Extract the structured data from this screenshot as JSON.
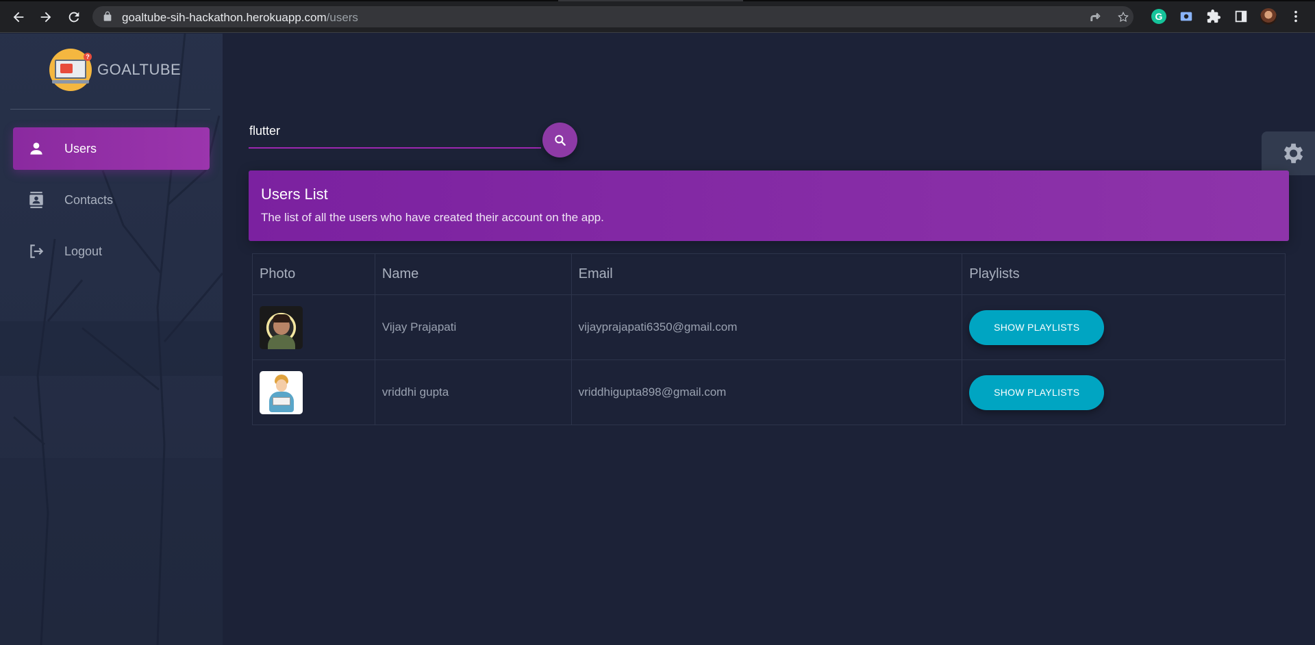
{
  "browser": {
    "url_host": "goaltube-sih-hackathon.herokuapp.com",
    "url_path": "/users",
    "icons": [
      "back-icon",
      "forward-icon",
      "reload-icon",
      "lock-icon",
      "share-icon",
      "star-icon",
      "grammarly-icon",
      "screencast-icon",
      "extensions-icon",
      "side-panel-icon",
      "profile-avatar",
      "menu-icon"
    ],
    "grammarly_letter": "G"
  },
  "sidebar": {
    "brand": "GOALTUBE",
    "items": [
      {
        "label": "Users",
        "icon": "person-icon",
        "active": true
      },
      {
        "label": "Contacts",
        "icon": "contacts-icon",
        "active": false
      },
      {
        "label": "Logout",
        "icon": "logout-icon",
        "active": false
      }
    ]
  },
  "search": {
    "value": "flutter",
    "button_icon": "search-icon"
  },
  "card": {
    "title": "Users List",
    "subtitle": "The list of all the users who have created their account on the app."
  },
  "table": {
    "headers": [
      "Photo",
      "Name",
      "Email",
      "Playlists"
    ],
    "rows": [
      {
        "name": "Vijay Prajapati",
        "email": "vijayprajapati6350@gmail.com",
        "button": "SHOW PLAYLISTS"
      },
      {
        "name": "vriddhi gupta",
        "email": "vriddhigupta898@gmail.com",
        "button": "SHOW PLAYLISTS"
      }
    ]
  },
  "colors": {
    "background": "#1c2237",
    "accent_purple": "#9c27b0",
    "button_cyan": "#00a5c2"
  }
}
